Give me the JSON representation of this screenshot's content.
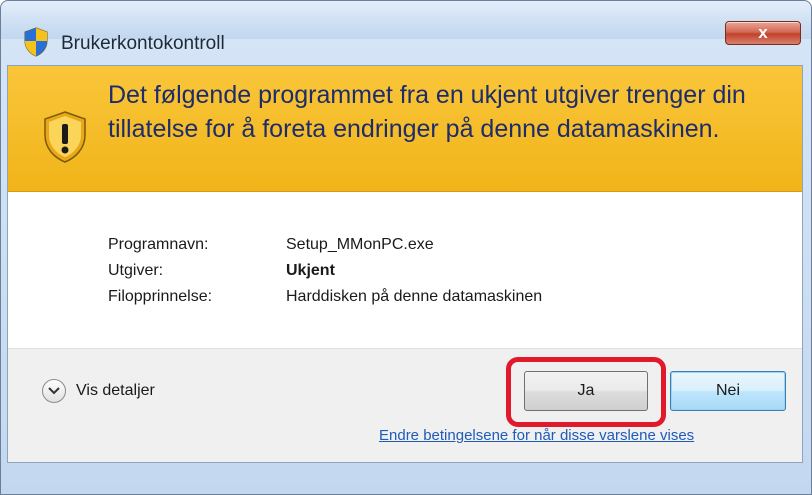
{
  "window": {
    "title": "Brukerkontokontroll",
    "close_label": "x"
  },
  "banner": {
    "message": "Det følgende programmet fra en ukjent utgiver trenger din tillatelse for å foreta endringer på denne datamaskinen."
  },
  "details": [
    {
      "label": "Programnavn:",
      "value": "Setup_MMonPC.exe",
      "bold": false
    },
    {
      "label": "Utgiver:",
      "value": "Ukjent",
      "bold": true
    },
    {
      "label": "Filopprinnelse:",
      "value": "Harddisken på denne datamaskinen",
      "bold": false
    }
  ],
  "footer": {
    "details_toggle_label": "Vis detaljer",
    "yes_label": "Ja",
    "no_label": "Nei",
    "settings_link": "Endre betingelsene for når disse varslene vises"
  },
  "colors": {
    "banner": "#f1b419",
    "banner_text": "#1e2c6b",
    "highlight": "#e01a2b",
    "link": "#1f5bb8",
    "close_button": "#c1412a"
  },
  "icons": {
    "title": "uac-shield-icon",
    "banner": "warning-shield-icon",
    "toggle": "chevron-down-icon"
  }
}
